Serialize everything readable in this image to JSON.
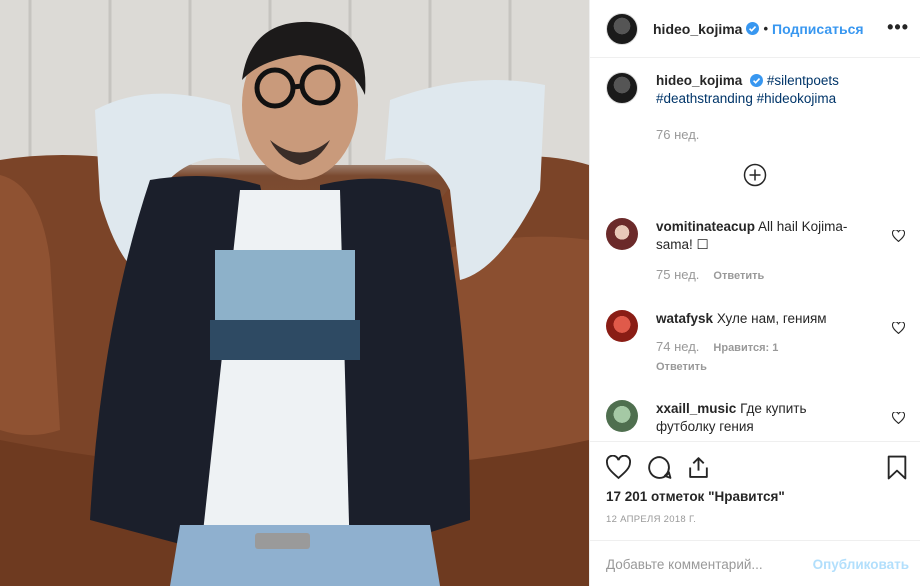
{
  "post": {
    "author": "hideo_kojima",
    "follow_label": "Подписаться",
    "more_label": "•••"
  },
  "caption": {
    "author": "hideo_kojima",
    "tags": [
      "#silentpoets",
      "#deathstranding",
      "#hideokojima"
    ],
    "time": "76 нед."
  },
  "comments": [
    {
      "user": "vomitinateacup",
      "text": "All hail Kojima-sama! ☐",
      "time": "75 нед.",
      "reply_label": "Ответить",
      "avatar_color": "#6b2a2a"
    },
    {
      "user": "watafysk",
      "text": "Хуле нам, гениям",
      "time": "74 нед.",
      "likes_label": "Нравится: 1",
      "reply_label": "Ответить",
      "avatar_color": "#c0392b"
    },
    {
      "user": "xxaill_music",
      "text": "Где купить футболку гения",
      "avatar_color": "#7fa37f"
    }
  ],
  "footer": {
    "likes": "17 201 отметок \"Нравится\"",
    "date": "12 АПРЕЛЯ 2018 Г.",
    "comment_placeholder": "Добавьте комментарий...",
    "publish_label": "Опубликовать"
  },
  "colors": {
    "link": "#3897f0",
    "hashtag": "#003569",
    "muted": "#999999",
    "verified": "#3897f0"
  }
}
